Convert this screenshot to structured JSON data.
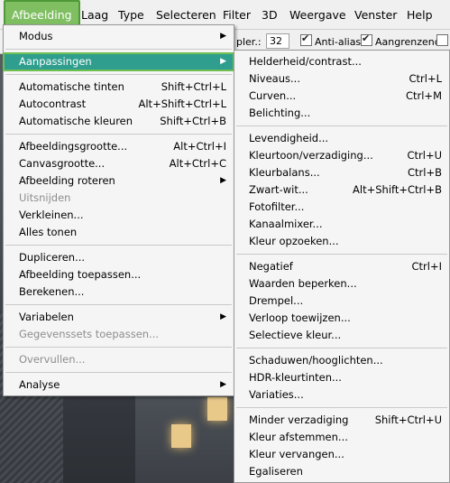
{
  "menubar": {
    "items": [
      "Afbeelding",
      "Laag",
      "Type",
      "Selecteren",
      "Filter",
      "3D",
      "Weergave",
      "Venster",
      "Help"
    ]
  },
  "options_bar": {
    "tolerance_label": "pler.:",
    "tolerance_value": "32",
    "anti_alias_label": "Anti-alias",
    "anti_alias_checked": true,
    "contiguous_label": "Aangrenzend",
    "contiguous_checked": true
  },
  "main_menu": {
    "modus": "Modus",
    "aanpassingen": "Aanpassingen",
    "auto_tinten": "Automatische tinten",
    "auto_tinten_sc": "Shift+Ctrl+L",
    "autocontrast": "Autocontrast",
    "autocontrast_sc": "Alt+Shift+Ctrl+L",
    "auto_kleuren": "Automatische kleuren",
    "auto_kleuren_sc": "Shift+Ctrl+B",
    "afbeeldingsgrootte": "Afbeeldingsgrootte...",
    "afbeeldingsgrootte_sc": "Alt+Ctrl+I",
    "canvasgrootte": "Canvasgrootte...",
    "canvasgrootte_sc": "Alt+Ctrl+C",
    "afbeelding_roteren": "Afbeelding roteren",
    "uitsnijden": "Uitsnijden",
    "verkleinen": "Verkleinen...",
    "alles_tonen": "Alles tonen",
    "dupliceren": "Dupliceren...",
    "afbeelding_toepassen": "Afbeelding toepassen...",
    "berekenen": "Berekenen...",
    "variabelen": "Variabelen",
    "gegevenssets": "Gegevenssets toepassen...",
    "overvullen": "Overvullen...",
    "analyse": "Analyse"
  },
  "sub_menu": {
    "helderheid": "Helderheid/contrast...",
    "niveaus": "Niveaus...",
    "niveaus_sc": "Ctrl+L",
    "curven": "Curven...",
    "curven_sc": "Ctrl+M",
    "belichting": "Belichting...",
    "levendigheid": "Levendigheid...",
    "kleurtoon": "Kleurtoon/verzadiging...",
    "kleurtoon_sc": "Ctrl+U",
    "kleurbalans": "Kleurbalans...",
    "kleurbalans_sc": "Ctrl+B",
    "zwart_wit": "Zwart-wit...",
    "zwart_wit_sc": "Alt+Shift+Ctrl+B",
    "fotofilter": "Fotofilter...",
    "kanaalmixer": "Kanaalmixer...",
    "kleur_opzoeken": "Kleur opzoeken...",
    "negatief": "Negatief",
    "negatief_sc": "Ctrl+I",
    "waarden_beperken": "Waarden beperken...",
    "drempel": "Drempel...",
    "verloop": "Verloop toewijzen...",
    "selectieve_kleur": "Selectieve kleur...",
    "schaduwen": "Schaduwen/hooglichten...",
    "hdr": "HDR-kleurtinten...",
    "variaties": "Variaties...",
    "minder_verzadiging": "Minder verzadiging",
    "minder_verzadiging_sc": "Shift+Ctrl+U",
    "kleur_afstemmen": "Kleur afstemmen...",
    "kleur_vervangen": "Kleur vervangen...",
    "egaliseren": "Egaliseren"
  },
  "icons": {
    "submenu_arrow": "chevron-right-icon",
    "checkbox_mark": "checkmark-icon"
  }
}
